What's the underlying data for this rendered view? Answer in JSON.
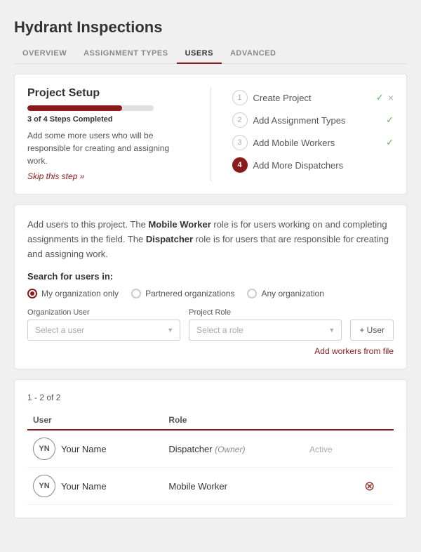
{
  "page": {
    "title": "Hydrant Inspections"
  },
  "nav": {
    "tabs": [
      {
        "label": "Overview",
        "active": false
      },
      {
        "label": "Assignment Types",
        "active": false
      },
      {
        "label": "Users",
        "active": true
      },
      {
        "label": "Advanced",
        "active": false
      }
    ]
  },
  "project_setup": {
    "title": "Project Setup",
    "progress_percent": 75,
    "progress_color": "#8b1a1a",
    "progress_bg": "#e0e0e0",
    "steps_text": "3 of 4 Steps Completed",
    "description": "Add some more users who will be responsible for creating and assigning work.",
    "skip_link": "Skip this step »",
    "steps": [
      {
        "num": "1",
        "label": "Create Project",
        "checked": true,
        "active": false
      },
      {
        "num": "2",
        "label": "Add Assignment Types",
        "checked": true,
        "active": false
      },
      {
        "num": "3",
        "label": "Add Mobile Workers",
        "checked": true,
        "active": false
      },
      {
        "num": "4",
        "label": "Add More Dispatchers",
        "checked": false,
        "active": true
      }
    ]
  },
  "users_section": {
    "info_text_1": "Add users to this project. The ",
    "bold_1": "Mobile Worker",
    "info_text_2": " role is for users working on and completing assignments in the field. The ",
    "bold_2": "Dispatcher",
    "info_text_3": " role is for users that are responsible for creating and assigning work.",
    "search_label": "Search for users in:",
    "radio_options": [
      {
        "label": "My organization only",
        "selected": true
      },
      {
        "label": "Partnered organizations",
        "selected": false
      },
      {
        "label": "Any organization",
        "selected": false
      }
    ],
    "org_user_label": "Organization User",
    "org_user_placeholder": "Select a user",
    "project_role_label": "Project Role",
    "project_role_placeholder": "Select a role",
    "add_user_btn": "+ User",
    "add_workers_link": "Add workers from file"
  },
  "table": {
    "count_text": "1 - 2 of 2",
    "columns": [
      "User",
      "Role"
    ],
    "rows": [
      {
        "avatar_initials": "YN",
        "user_name": "Your Name",
        "role": "Dispatcher",
        "role_sub": "(Owner)",
        "status": "Active",
        "removable": false
      },
      {
        "avatar_initials": "YN",
        "user_name": "Your Name",
        "role": "Mobile Worker",
        "role_sub": "",
        "status": "",
        "removable": true
      }
    ]
  }
}
